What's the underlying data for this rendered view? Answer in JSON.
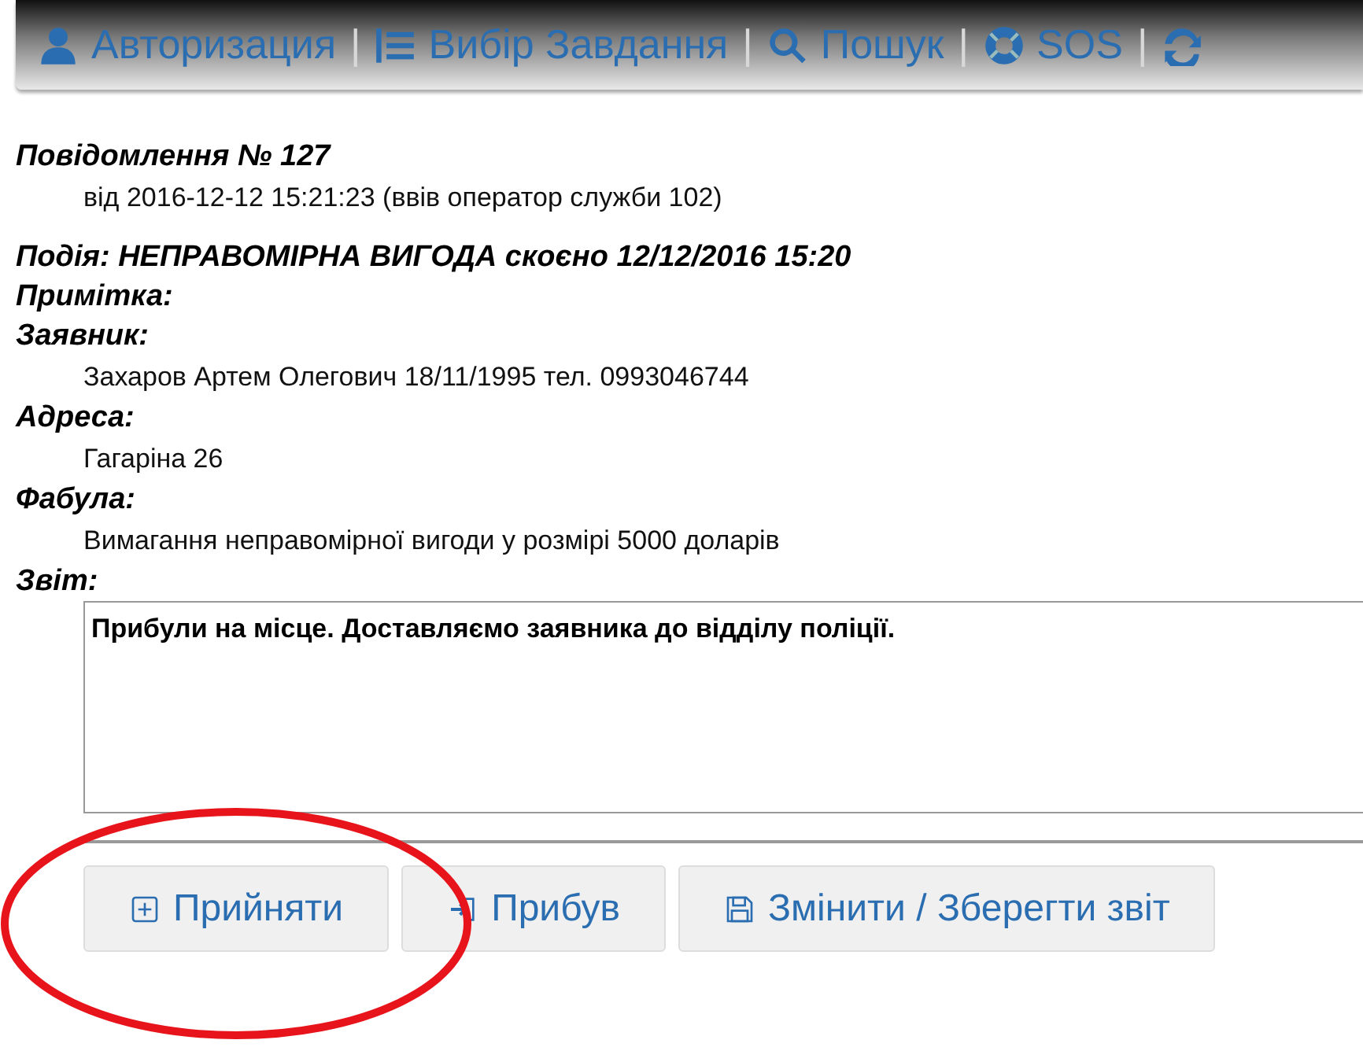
{
  "nav": [
    {
      "kind": "user",
      "label": "Авторизация",
      "separator": "|"
    },
    {
      "kind": "list",
      "label": "Вибір Завдання",
      "separator": "|"
    },
    {
      "kind": "search",
      "label": "Пошук",
      "separator": "|"
    },
    {
      "kind": "lifebuoy",
      "label": "SOS",
      "separator": "|"
    },
    {
      "kind": "refresh"
    }
  ],
  "message": {
    "title": "Повідомлення № 127",
    "subtitle": "від 2016-12-12 15:21:23 (ввів оператор служби 102)"
  },
  "fields": [
    {
      "label": "Подія: НЕПРАВОМІРНА ВИГОДА скоєно 12/12/2016 15:20"
    },
    {
      "label": "Примітка:"
    },
    {
      "label": "Заявник:",
      "value": "Захаров Артем Олегович 18/11/1995 тел. 0993046744"
    },
    {
      "label": "Адреса:",
      "value": "Гагаріна 26"
    },
    {
      "label": "Фабула:",
      "value": "Вимагання неправомірної вигоди у розмірі 5000 доларів"
    },
    {
      "label": "Звіт:"
    }
  ],
  "report": {
    "value": "Прибули на місце. Доставляємо заявника до відділу поліції."
  },
  "buttons": [
    {
      "kind": "accept",
      "label": "Прийняти",
      "highlighted": true
    },
    {
      "kind": "arrive",
      "label": "Прибув",
      "highlighted": false
    },
    {
      "kind": "save",
      "label": "Змінити / Зберегти звіт",
      "highlighted": false
    }
  ]
}
